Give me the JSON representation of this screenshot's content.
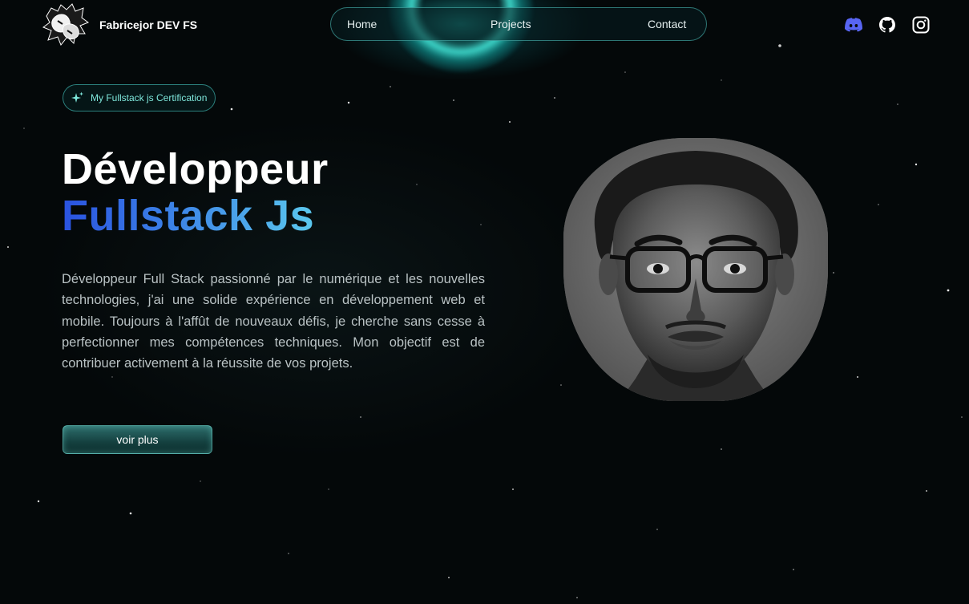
{
  "header": {
    "brand": "Fabricejor DEV FS",
    "nav": [
      {
        "label": "Home"
      },
      {
        "label": "Projects"
      },
      {
        "label": "Contact"
      }
    ],
    "socials": [
      {
        "icon": "discord-icon",
        "color": "#5865F2"
      },
      {
        "icon": "github-icon",
        "color": "#ffffff"
      },
      {
        "icon": "instagram-icon",
        "color": "#ffffff"
      }
    ]
  },
  "hero": {
    "badge_label": "My Fullstack js Certification",
    "title_line1": "Développeur",
    "title_line2": "Fullstack Js",
    "bio": "Développeur Full Stack passionné par le numérique et les nouvelles technologies, j'ai une solide expérience en développement web et mobile. Toujours à l'affût de nouveaux défis, je cherche sans cesse à perfectionner mes compétences techniques. Mon objectif est de contribuer activement à la réussite de vos projets.",
    "cta_label": "voir plus"
  },
  "colors": {
    "background": "#040809",
    "accent_teal": "#7fe8dc",
    "gradient_start": "#2a52e0",
    "gradient_end": "#5bc8ee",
    "discord": "#5865F2"
  }
}
